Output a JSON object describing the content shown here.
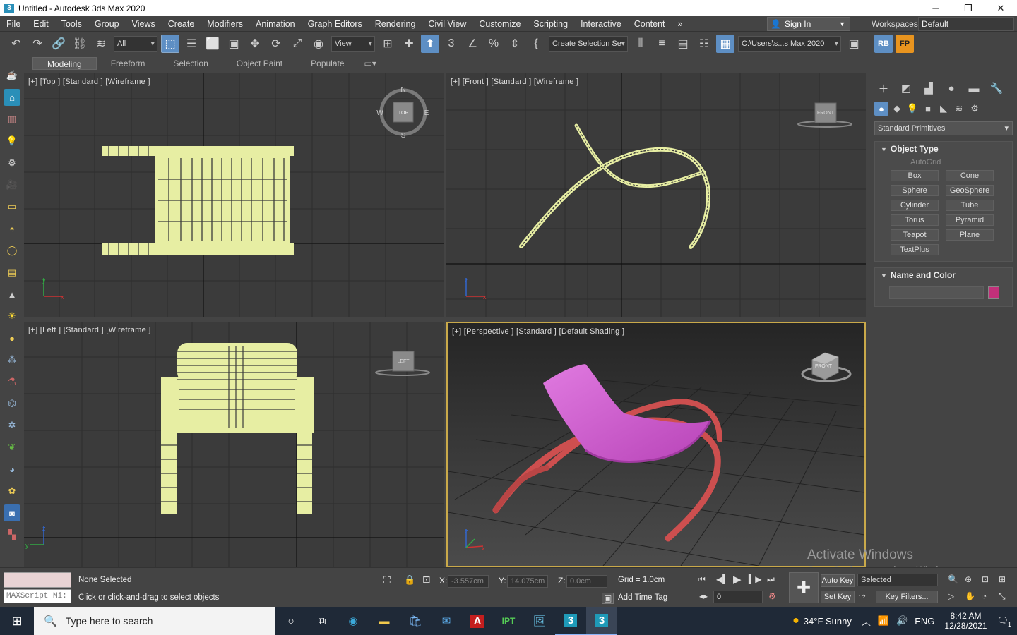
{
  "window": {
    "title": "Untitled - Autodesk 3ds Max 2020",
    "app_icon_letter": "3",
    "controls": [
      "minimize-icon",
      "restore-icon",
      "close-icon"
    ]
  },
  "menu": {
    "items": [
      "File",
      "Edit",
      "Tools",
      "Group",
      "Views",
      "Create",
      "Modifiers",
      "Animation",
      "Graph Editors",
      "Rendering",
      "Civil View",
      "Customize",
      "Scripting",
      "Interactive",
      "Content"
    ],
    "overflow": "»",
    "sign_in": "Sign In",
    "workspaces_label": "Workspaces:",
    "workspace": "Default"
  },
  "toolbar": {
    "filter": "All",
    "ref_coord": "View",
    "selection_set": "Create Selection Se",
    "project_path": "C:\\Users\\s...s Max 2020",
    "rb": "RB",
    "fp": "FP"
  },
  "ribbon": {
    "tabs": [
      "Modeling",
      "Freeform",
      "Selection",
      "Object Paint",
      "Populate"
    ],
    "active": "Modeling"
  },
  "viewports": {
    "top": {
      "label": "[+] [Top ] [Standard ] [Wireframe ]",
      "compass": {
        "n": "N",
        "s": "S",
        "e": "E",
        "w": "W",
        "cube": "TOP"
      }
    },
    "front": {
      "label": "[+] [Front ] [Standard ] [Wireframe ]",
      "cube": "FRONT"
    },
    "left": {
      "label": "[+] [Left ] [Standard ] [Wireframe ]",
      "cube": "LEFT"
    },
    "perspective": {
      "label": "[+] [Perspective ] [Standard ] [Default Shading ]",
      "cube": "FRONT"
    },
    "axis": {
      "x": "x",
      "y": "y",
      "z": "z"
    }
  },
  "command_panel": {
    "category": "Standard Primitives",
    "object_type_title": "Object Type",
    "autogrid": "AutoGrid",
    "primitives": [
      "Box",
      "Cone",
      "Sphere",
      "GeoSphere",
      "Cylinder",
      "Tube",
      "Torus",
      "Pyramid",
      "Teapot",
      "Plane",
      "TextPlus"
    ],
    "name_color_title": "Name and Color",
    "color_swatch": "#c2307a"
  },
  "status": {
    "maxscript_placeholder": "MAXScript Mi:",
    "selection": "None Selected",
    "prompt": "Click or click-and-drag to select objects",
    "x_label": "X:",
    "x": "-3.557cm",
    "y_label": "Y:",
    "y": "14.075cm",
    "z_label": "Z:",
    "z": "0.0cm",
    "grid": "Grid = 1.0cm",
    "add_time_tag": "Add Time Tag",
    "frame": "0",
    "auto_key": "Auto Key",
    "set_key": "Set Key",
    "key_mode": "Selected",
    "key_filters": "Key Filters..."
  },
  "watermark": {
    "line1": "Activate Windows",
    "line2": "Go to Settings to activate Windows."
  },
  "taskbar": {
    "search_placeholder": "Type here to search",
    "weather": "34°F  Sunny",
    "lang": "ENG",
    "time": "8:42 AM",
    "date": "12/28/2021",
    "notif_count": "1",
    "ipt": "IPT",
    "acrobat": "A"
  },
  "colors": {
    "wireframe": "#e7eea3",
    "chair_frame": "#cd4f4f",
    "chair_seat": "#d65ad8",
    "grid_line": "#2c2c2c",
    "active_border": "#c9a94a"
  }
}
